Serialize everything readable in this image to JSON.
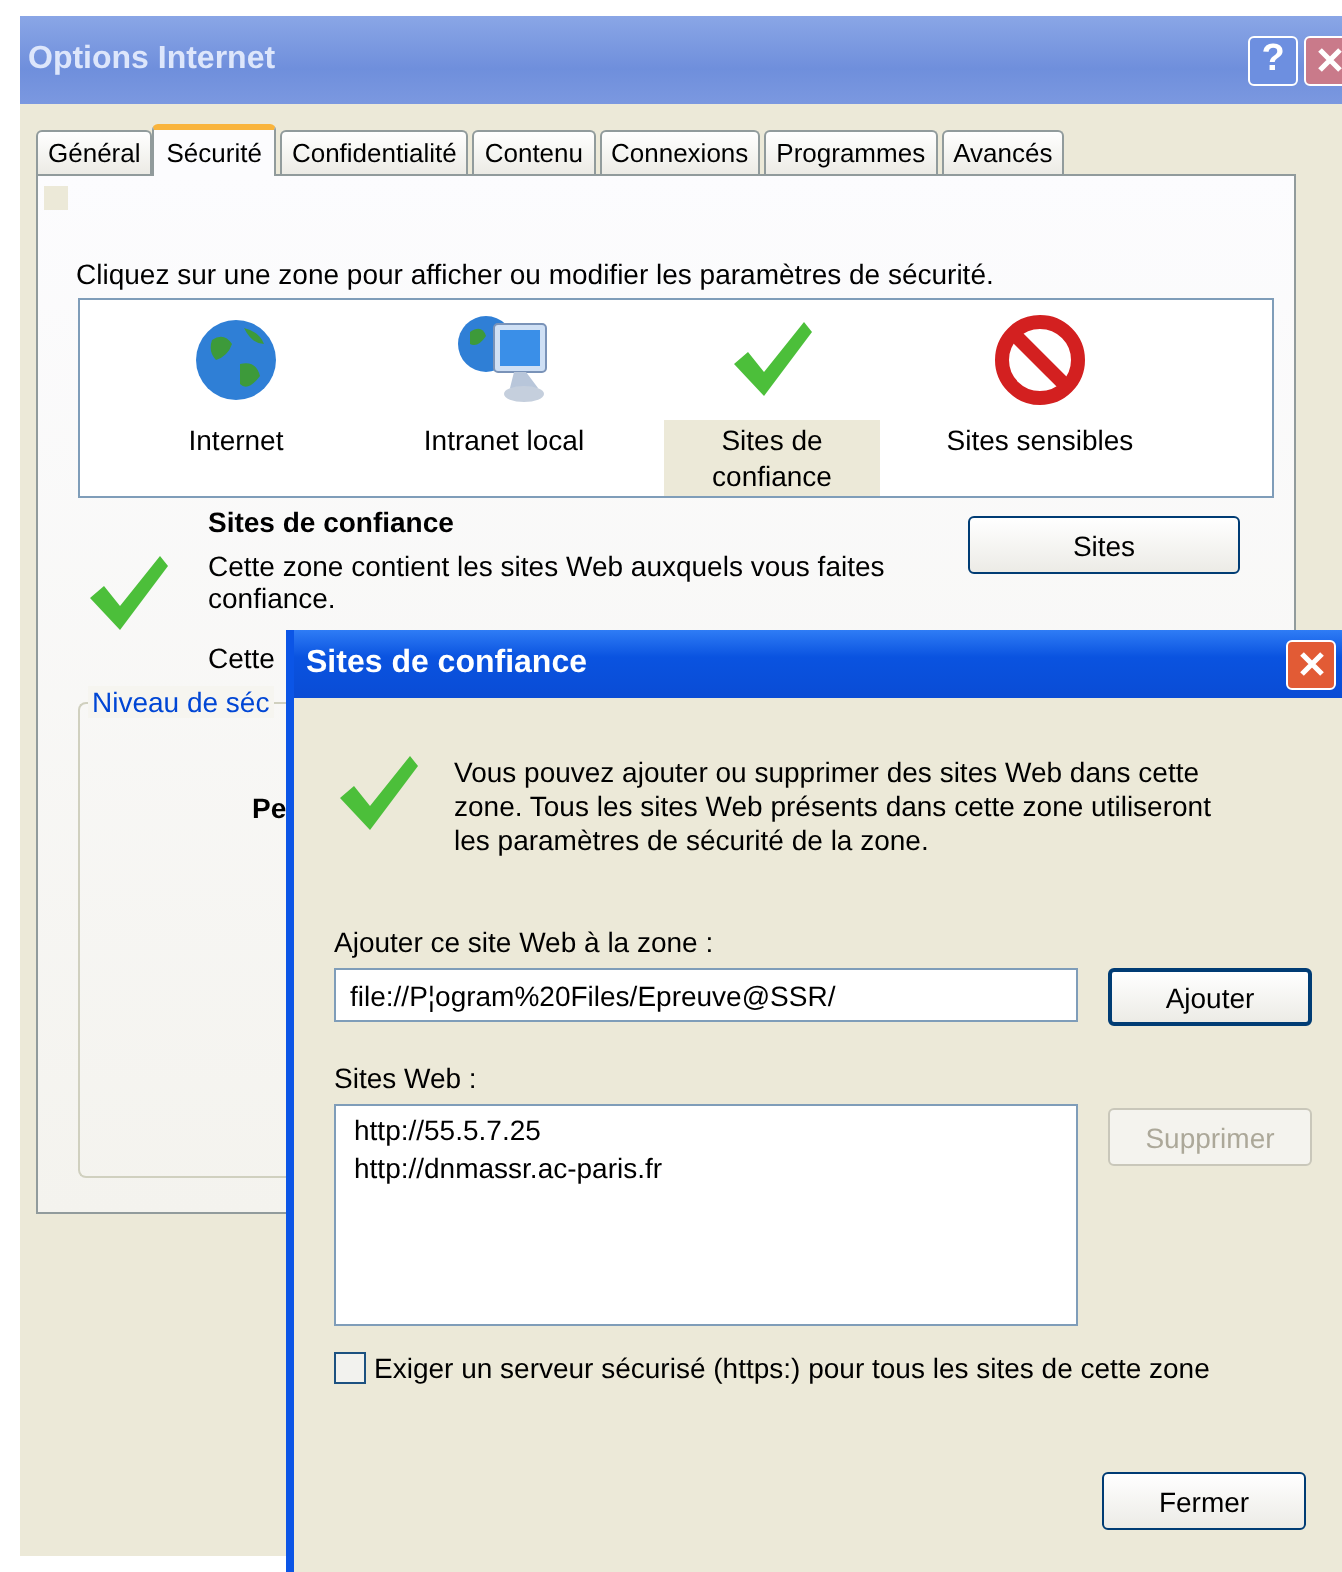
{
  "window": {
    "title": "Options Internet",
    "help_button": "?"
  },
  "tabs": [
    {
      "label": "Général",
      "selected": false
    },
    {
      "label": "Sécurité",
      "selected": true
    },
    {
      "label": "Confidentialité",
      "selected": false
    },
    {
      "label": "Contenu",
      "selected": false
    },
    {
      "label": "Connexions",
      "selected": false
    },
    {
      "label": "Programmes",
      "selected": false
    },
    {
      "label": "Avancés",
      "selected": false
    }
  ],
  "security": {
    "instruction": "Cliquez sur une zone pour afficher ou modifier les paramètres de sécurité.",
    "zones": [
      {
        "label": "Internet",
        "kind": "globe",
        "selected": false
      },
      {
        "label": "Intranet local",
        "kind": "intranet",
        "selected": false
      },
      {
        "label": "Sites de confiance",
        "kind": "check",
        "selected": true
      },
      {
        "label": "Sites sensibles",
        "kind": "blocked",
        "selected": false
      }
    ],
    "zone_title": "Sites de confiance",
    "zone_description": "Cette zone contient les sites Web auxquels vous faites confiance.",
    "sites_button": "Sites",
    "zone_note": "Cette",
    "level_group": "Niveau de séc",
    "level_text": "Pe"
  },
  "dialog": {
    "title": "Sites de confiance",
    "description": "Vous pouvez ajouter ou supprimer des sites Web dans cette zone. Tous les sites Web présents dans cette zone utiliseront les paramètres de sécurité de la zone.",
    "add_label": "Ajouter ce site Web à la zone :",
    "add_value": "file://P¦ogram%20Files/Epreuve@SSR/",
    "add_button": "Ajouter",
    "list_label": "Sites Web :",
    "sites": [
      "http://55.5.7.25",
      "http://dnmassr.ac-paris.fr"
    ],
    "remove_button": {
      "label": "Supprimer",
      "disabled": true
    },
    "https_required": {
      "label": "Exiger un serveur sécurisé (https:) pour tous les sites de cette zone",
      "checked": false
    },
    "close_button": "Fermer"
  }
}
